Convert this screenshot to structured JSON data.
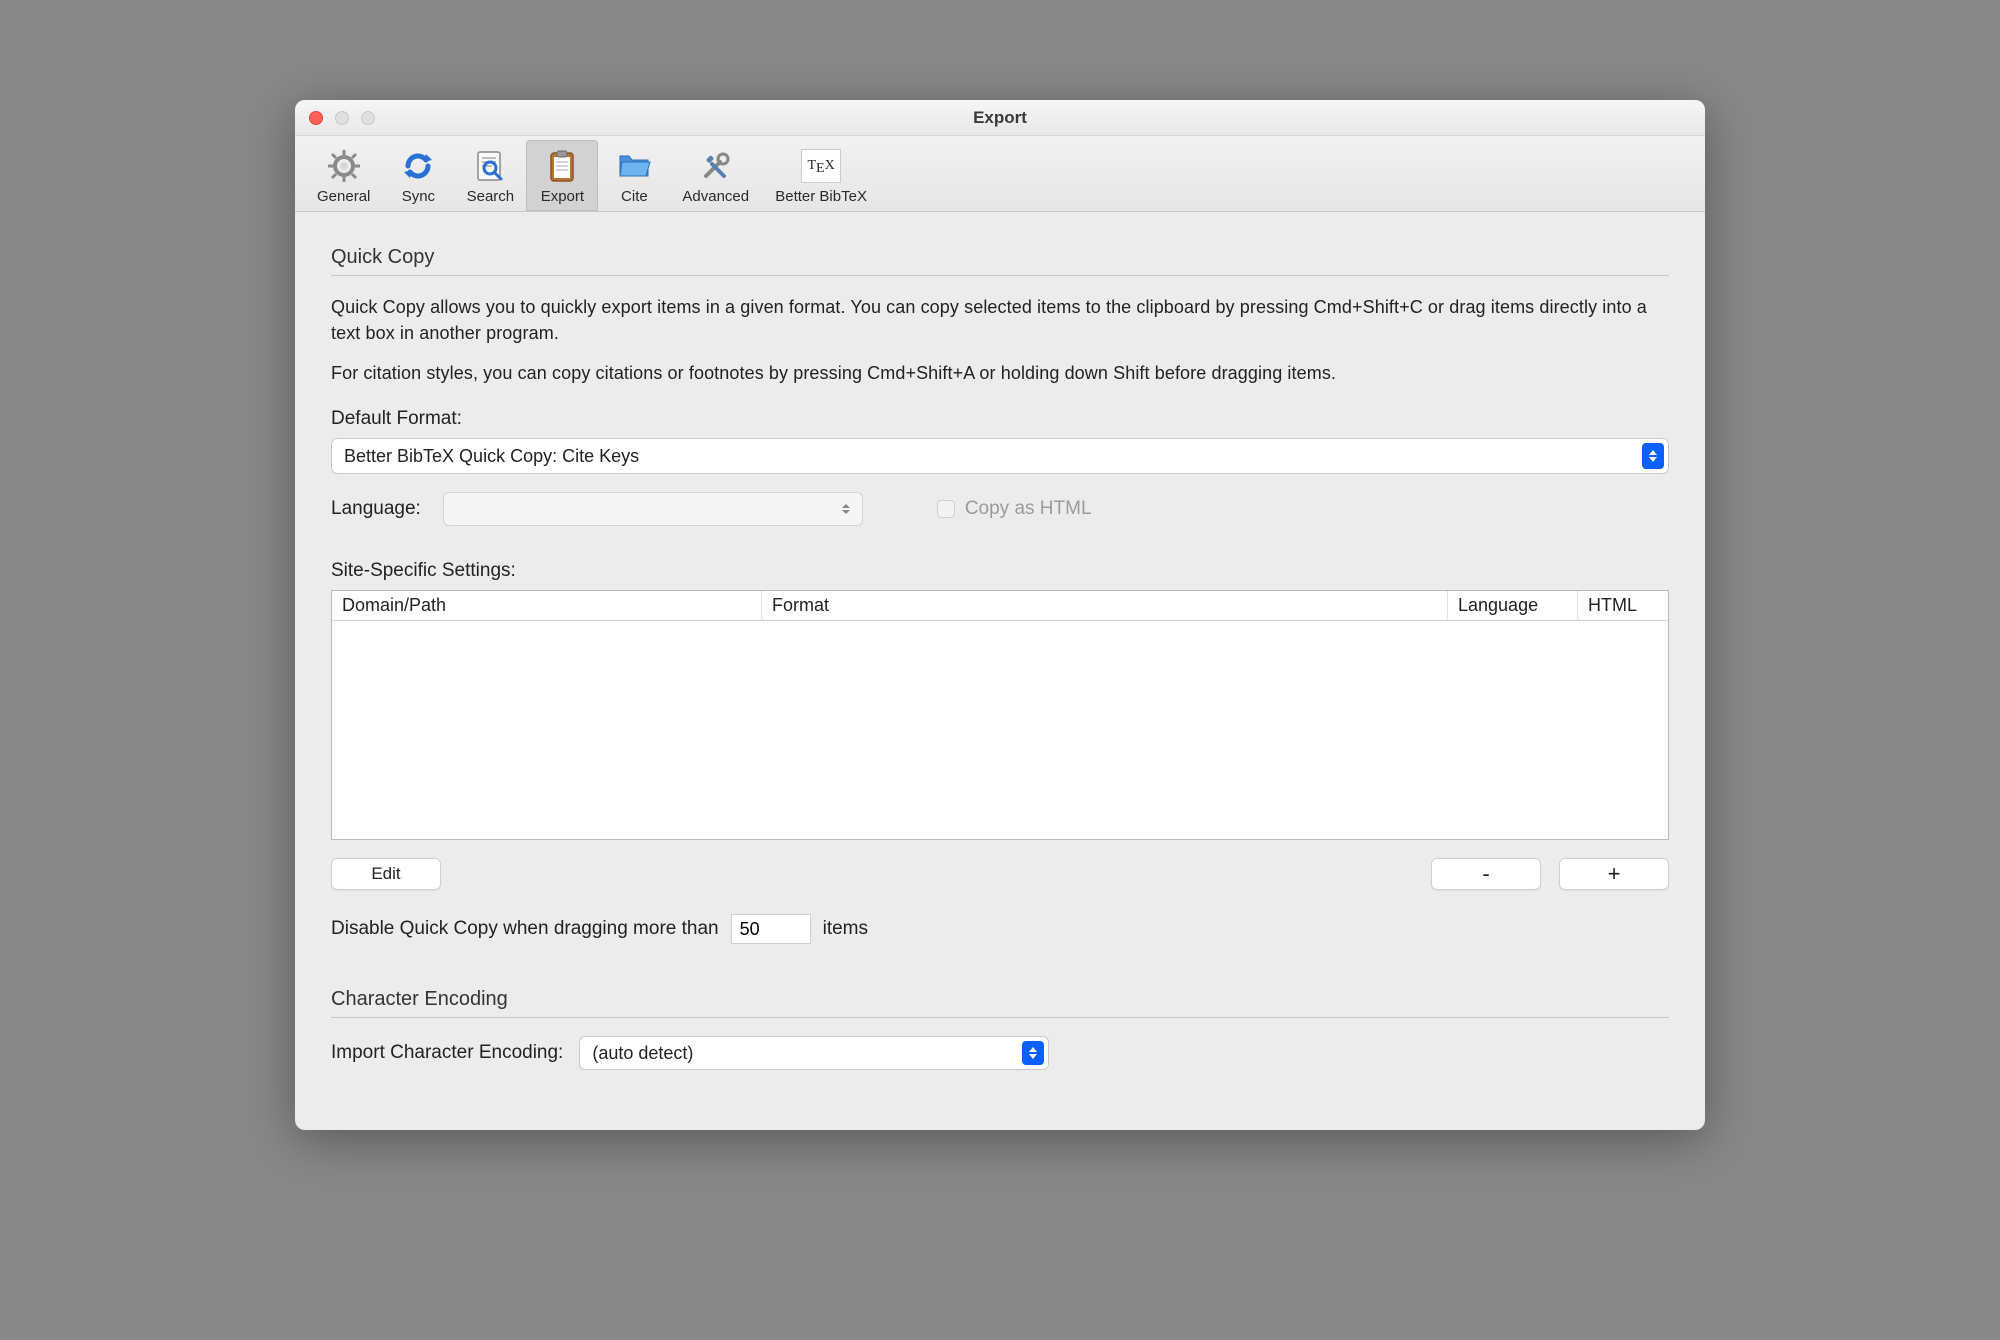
{
  "window": {
    "title": "Export"
  },
  "toolbar": {
    "items": [
      {
        "id": "general",
        "label": "General"
      },
      {
        "id": "sync",
        "label": "Sync"
      },
      {
        "id": "search",
        "label": "Search"
      },
      {
        "id": "export",
        "label": "Export"
      },
      {
        "id": "cite",
        "label": "Cite"
      },
      {
        "id": "advanced",
        "label": "Advanced"
      },
      {
        "id": "better-bibtex",
        "label": "Better BibTeX"
      }
    ],
    "selected": "export"
  },
  "quickcopy": {
    "header": "Quick Copy",
    "description1": "Quick Copy allows you to quickly export items in a given format. You can copy selected items to the clipboard by pressing Cmd+Shift+C or drag items directly into a text box in another program.",
    "description2": "For citation styles, you can copy citations or footnotes by pressing Cmd+Shift+A or holding down Shift before dragging items.",
    "defaultFormat_label": "Default Format:",
    "defaultFormat_value": "Better BibTeX Quick Copy: Cite Keys",
    "language_label": "Language:",
    "language_value": "",
    "copyAsHtml_label": "Copy as HTML",
    "copyAsHtml_checked": false,
    "siteSettings_label": "Site-Specific Settings:",
    "table": {
      "columns": {
        "domain": "Domain/Path",
        "format": "Format",
        "language": "Language",
        "html": "HTML"
      },
      "rows": []
    },
    "edit_label": "Edit",
    "minus_label": "-",
    "plus_label": "+",
    "disableDragging_before": "Disable Quick Copy when dragging more than",
    "disableDragging_value": "50",
    "disableDragging_after": "items"
  },
  "encoding": {
    "header": "Character Encoding",
    "import_label": "Import Character Encoding:",
    "import_value": "(auto detect)"
  }
}
